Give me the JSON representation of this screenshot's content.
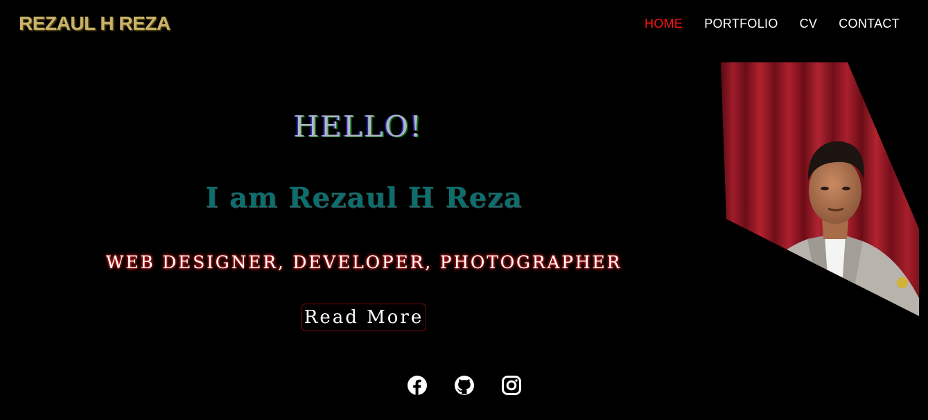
{
  "header": {
    "brand": "REZAUL H REZA",
    "nav": [
      {
        "label": "HOME",
        "active": true
      },
      {
        "label": "PORTFOLIO",
        "active": false
      },
      {
        "label": "CV",
        "active": false
      },
      {
        "label": "CONTACT",
        "active": false
      }
    ]
  },
  "hero": {
    "greeting": "HELLO!",
    "intro": "I am Rezaul H Reza",
    "roles": "WEB DESIGNER, DEVELOPER, PHOTOGRAPHER",
    "cta_label": "Read More"
  },
  "social": [
    {
      "icon": "facebook-icon"
    },
    {
      "icon": "github-icon"
    },
    {
      "icon": "instagram-icon"
    }
  ],
  "colors": {
    "background": "#000000",
    "brand": "#c9b36a",
    "nav_active": "#ff1414",
    "intro": "#0d6e6e",
    "roles_glow": "#ff1f1f",
    "cta_border": "#7a0a0a"
  }
}
